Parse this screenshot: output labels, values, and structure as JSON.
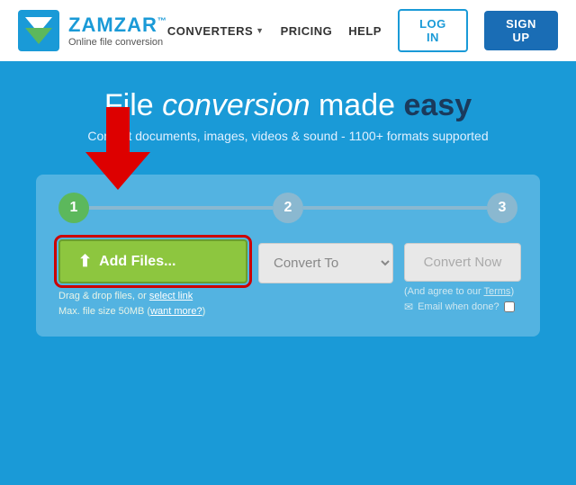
{
  "navbar": {
    "logo_name": "ZAMZAR",
    "logo_tm": "™",
    "logo_tagline": "Online file conversion",
    "nav_converters": "CONVERTERS",
    "nav_pricing": "PRICING",
    "nav_help": "HELP",
    "btn_login": "LOG IN",
    "btn_signup": "SIGN UP"
  },
  "hero": {
    "headline_part1": "File ",
    "headline_italic": "conversion",
    "headline_part2": " made ",
    "headline_bold": "easy",
    "subtext": "Convert documents, images, videos & sound - 1100+ formats supported"
  },
  "converter": {
    "step1_label": "1",
    "step2_label": "2",
    "step3_label": "3",
    "add_files_btn": "Add Files...",
    "drag_drop_text": "Drag & drop files, or",
    "select_link": "select link",
    "max_size_text": "Max. file size 50MB (",
    "want_more_link": "want more?",
    "convert_to_placeholder": "Convert To",
    "convert_now_btn": "Convert Now",
    "agree_text": "(And agree to our",
    "terms_link": "Terms",
    "agree_end": ")",
    "email_label": "Email when done?",
    "icons": {
      "upload": "⬆",
      "email": "✉"
    }
  },
  "colors": {
    "primary_blue": "#1a9ad7",
    "dark_blue": "#1a3a5c",
    "green": "#8dc63f",
    "red_arrow": "#cc0000"
  }
}
